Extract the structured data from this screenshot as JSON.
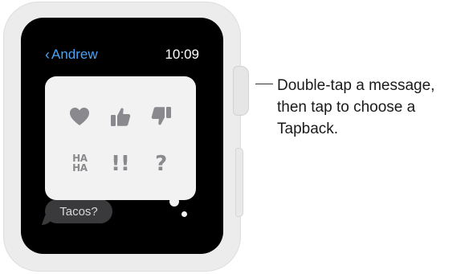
{
  "watch": {
    "status_bar": {
      "back_label": "Andrew",
      "time": "10:09"
    },
    "message": {
      "text": "Tacos?"
    },
    "tapback": {
      "options": [
        {
          "name": "heart-icon",
          "label": "Heart"
        },
        {
          "name": "thumbs-up-icon",
          "label": "Thumbs Up"
        },
        {
          "name": "thumbs-down-icon",
          "label": "Thumbs Down"
        },
        {
          "name": "haha-icon",
          "label": "HA HA"
        },
        {
          "name": "exclamation-icon",
          "label": "!!"
        },
        {
          "name": "question-icon",
          "label": "?"
        }
      ],
      "haha_line1": "HA",
      "haha_line2": "HA",
      "exclaim": "!!",
      "question": "?"
    }
  },
  "callout": {
    "text": "Double-tap a message,\nthen tap to choose a\nTapback."
  },
  "colors": {
    "accent": "#4aa3f5",
    "screen": "#000000",
    "panel": "#f2f2f2",
    "icon": "#8a8a8e"
  }
}
